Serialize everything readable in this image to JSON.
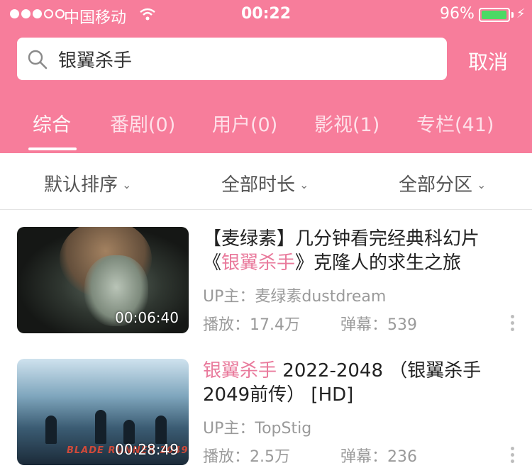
{
  "status_bar": {
    "carrier": "中国移动",
    "time": "00:22",
    "battery_percent": "96%",
    "battery_level": 0.96,
    "battery_color": "#4cd964"
  },
  "search": {
    "query": "银翼杀手",
    "cancel_label": "取消"
  },
  "tabs": [
    {
      "label": "综合",
      "active": true
    },
    {
      "label": "番剧(0)",
      "active": false
    },
    {
      "label": "用户(0)",
      "active": false
    },
    {
      "label": "影视(1)",
      "active": false
    },
    {
      "label": "专栏(41)",
      "active": false
    }
  ],
  "filters": [
    {
      "label": "默认排序"
    },
    {
      "label": "全部时长"
    },
    {
      "label": "全部分区"
    }
  ],
  "results": [
    {
      "title_line1": "【麦绿素】几分钟看完经典科幻片",
      "title_line2_pre": "《",
      "title_line2_hl": "银翼杀手",
      "title_line2_post": "》克隆人的求生之旅",
      "uploader": "UP主：麦绿素dustdream",
      "plays": "播放：17.4万",
      "danmaku": "弹幕：539",
      "duration": "00:06:40"
    },
    {
      "title_line1_hl": "银翼杀手",
      "title_line1_post": " 2022-2048 （银翼杀手",
      "title_line2": "2049前传） [HD]",
      "uploader": "UP主：TopStig",
      "plays": "播放：2.5万",
      "danmaku": "弹幕：236",
      "duration": "00:28:49",
      "thumb_logo": "BLADE RUNNER 2049"
    }
  ],
  "colors": {
    "brand_pink": "#f77d9b",
    "highlight": "#e97a9c"
  }
}
